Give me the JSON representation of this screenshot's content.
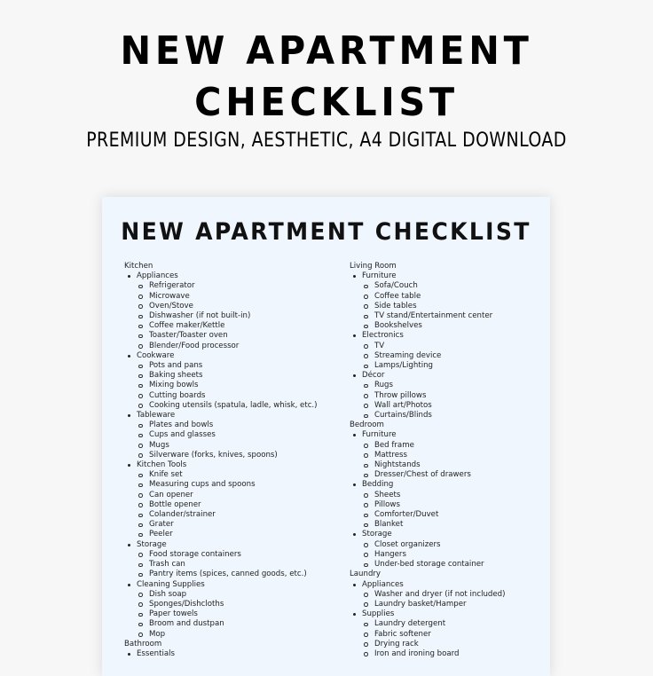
{
  "hero": {
    "title_line1": "NEW APARTMENT",
    "title_line2": "CHECKLIST",
    "subtitle": "PREMIUM DESIGN, AESTHETIC, A4 DIGITAL DOWNLOAD"
  },
  "document": {
    "title": "NEW APARTMENT CHECKLIST",
    "background_color": "#f0f6fd",
    "left_column": [
      {
        "section": "Kitchen",
        "groups": [
          {
            "label": "Appliances",
            "items": [
              "Refrigerator",
              "Microwave",
              "Oven/Stove",
              "Dishwasher (if not built-in)",
              "Coffee maker/Kettle",
              "Toaster/Toaster oven",
              "Blender/Food processor"
            ]
          },
          {
            "label": "Cookware",
            "items": [
              "Pots and pans",
              "Baking sheets",
              "Mixing bowls",
              "Cutting boards",
              "Cooking utensils (spatula, ladle, whisk, etc.)"
            ]
          },
          {
            "label": "Tableware",
            "items": [
              "Plates and bowls",
              "Cups and glasses",
              "Mugs",
              "Silverware (forks, knives, spoons)"
            ]
          },
          {
            "label": "Kitchen Tools",
            "items": [
              "Knife set",
              "Measuring cups and spoons",
              "Can opener",
              "Bottle opener",
              "Colander/strainer",
              "Grater",
              "Peeler"
            ]
          },
          {
            "label": "Storage",
            "items": [
              "Food storage containers",
              "Trash can",
              "Pantry items (spices, canned goods, etc.)"
            ]
          },
          {
            "label": "Cleaning Supplies",
            "items": [
              "Dish soap",
              "Sponges/Dishcloths",
              "Paper towels",
              "Broom and dustpan",
              "Mop"
            ]
          }
        ]
      },
      {
        "section": "Bathroom",
        "groups": [
          {
            "label": "Essentials",
            "items": []
          }
        ]
      }
    ],
    "right_column": [
      {
        "section": "Living Room",
        "groups": [
          {
            "label": "Furniture",
            "items": [
              "Sofa/Couch",
              "Coffee table",
              "Side tables",
              "TV stand/Entertainment center",
              "Bookshelves"
            ]
          },
          {
            "label": "Electronics",
            "items": [
              "TV",
              "Streaming device",
              "Lamps/Lighting"
            ]
          },
          {
            "label": "Décor",
            "items": [
              "Rugs",
              "Throw pillows",
              "Wall art/Photos",
              "Curtains/Blinds"
            ]
          }
        ]
      },
      {
        "section": "Bedroom",
        "groups": [
          {
            "label": "Furniture",
            "items": [
              "Bed frame",
              "Mattress",
              "Nightstands",
              "Dresser/Chest of drawers"
            ]
          },
          {
            "label": "Bedding",
            "items": [
              "Sheets",
              "Pillows",
              "Comforter/Duvet",
              "Blanket"
            ]
          },
          {
            "label": "Storage",
            "items": [
              "Closet organizers",
              "Hangers",
              "Under-bed storage container"
            ]
          }
        ]
      },
      {
        "section": "Laundry",
        "groups": [
          {
            "label": "Appliances",
            "items": [
              "Washer and dryer (if not included)",
              "Laundry basket/Hamper"
            ]
          },
          {
            "label": "Supplies",
            "items": [
              "Laundry detergent",
              "Fabric softener",
              "Drying rack",
              "Iron and ironing board"
            ]
          }
        ]
      }
    ]
  }
}
